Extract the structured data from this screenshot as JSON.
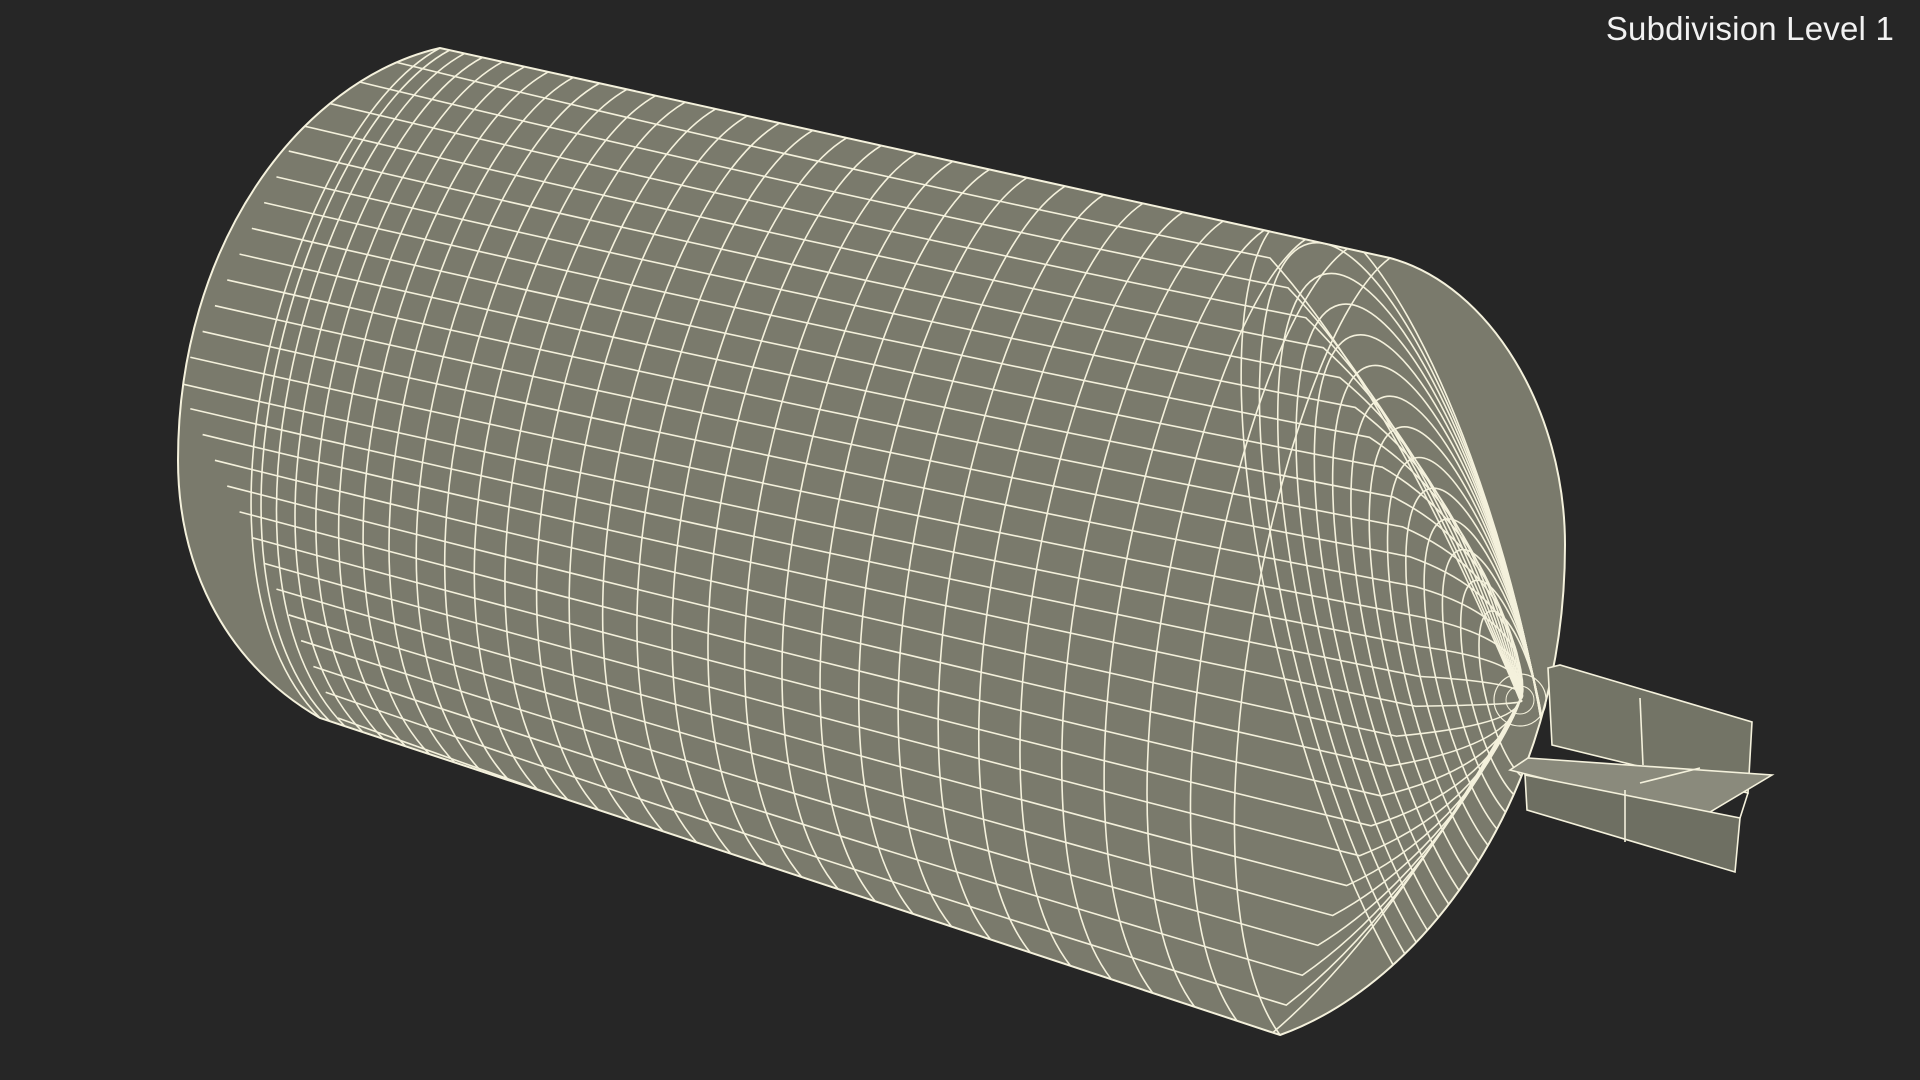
{
  "overlay": {
    "label": "Subdivision Level 1"
  },
  "colors": {
    "background": "#262626",
    "surface": "#7a7a6c",
    "wireframe": "#f4f1dc",
    "label_text": "#f2f2f2"
  },
  "scene": {
    "object": "cylinder-tank-wireframe",
    "fin_assembly": "cross-fin"
  }
}
